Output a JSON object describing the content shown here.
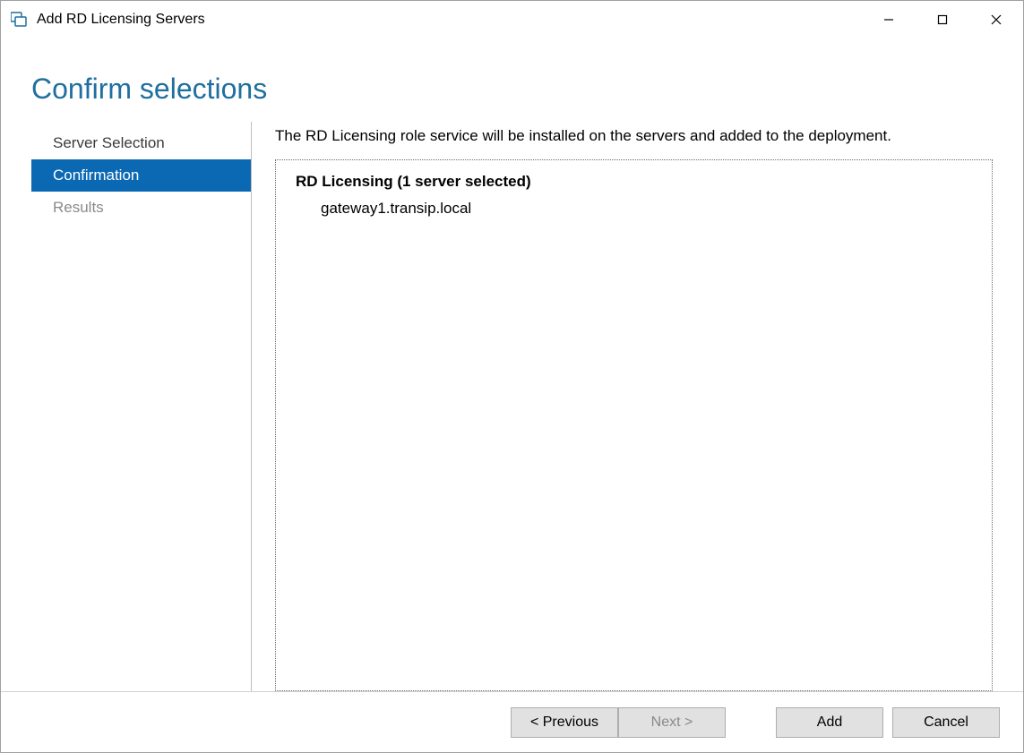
{
  "window": {
    "title": "Add RD Licensing Servers"
  },
  "page": {
    "heading": "Confirm selections",
    "description": "The RD Licensing role service will be installed on the servers and added to the deployment."
  },
  "sidebar": {
    "items": [
      {
        "label": "Server Selection",
        "state": "normal"
      },
      {
        "label": "Confirmation",
        "state": "selected"
      },
      {
        "label": "Results",
        "state": "disabled"
      }
    ]
  },
  "panel": {
    "heading": "RD Licensing  (1 server selected)",
    "servers": [
      "gateway1.transip.local"
    ]
  },
  "footer": {
    "previous": "< Previous",
    "next": "Next >",
    "add": "Add",
    "cancel": "Cancel"
  }
}
